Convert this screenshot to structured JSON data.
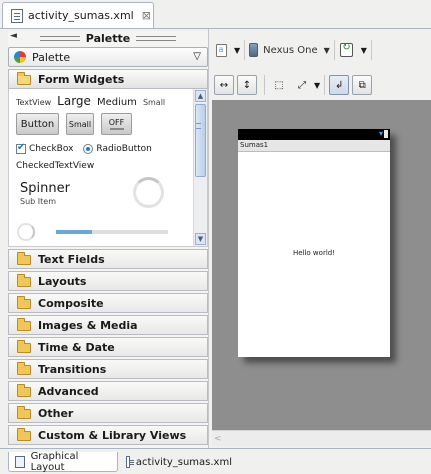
{
  "editor_tab": {
    "title": "activity_sumas.xml",
    "close": "⊠"
  },
  "palette": {
    "title": "Palette",
    "collapse": "◄",
    "selector_label": "Palette",
    "selector_arrow": "▽",
    "open_category": "Form Widgets",
    "widgets": {
      "textview": "TextView",
      "large": "Large",
      "medium": "Medium",
      "small": "Small",
      "button": "Button",
      "small_button": "Small",
      "toggle": "OFF",
      "checkbox": "CheckBox",
      "radio": "RadioButton",
      "checked_textview": "CheckedTextView",
      "spinner": "Spinner",
      "spinner_sub": "Sub Item",
      "progress_fill": 0.32
    },
    "categories": [
      "Text Fields",
      "Layouts",
      "Composite",
      "Images & Media",
      "Time & Date",
      "Transitions",
      "Advanced",
      "Other",
      "Custom & Library Views"
    ],
    "scroll_up": "▲",
    "scroll_down": "▼"
  },
  "toolbar": {
    "device": "Nexus One",
    "dropdown": "▼"
  },
  "preview": {
    "app_title": "Sumas1",
    "hello": "Hello world!"
  },
  "bottom_tabs": {
    "graphical": "Graphical Layout",
    "xml": "activity_sumas.xml"
  },
  "colors": {
    "canvas_bg": "#8e8e8e",
    "accent": "#3ea0e0",
    "folder": "#f0c659"
  }
}
